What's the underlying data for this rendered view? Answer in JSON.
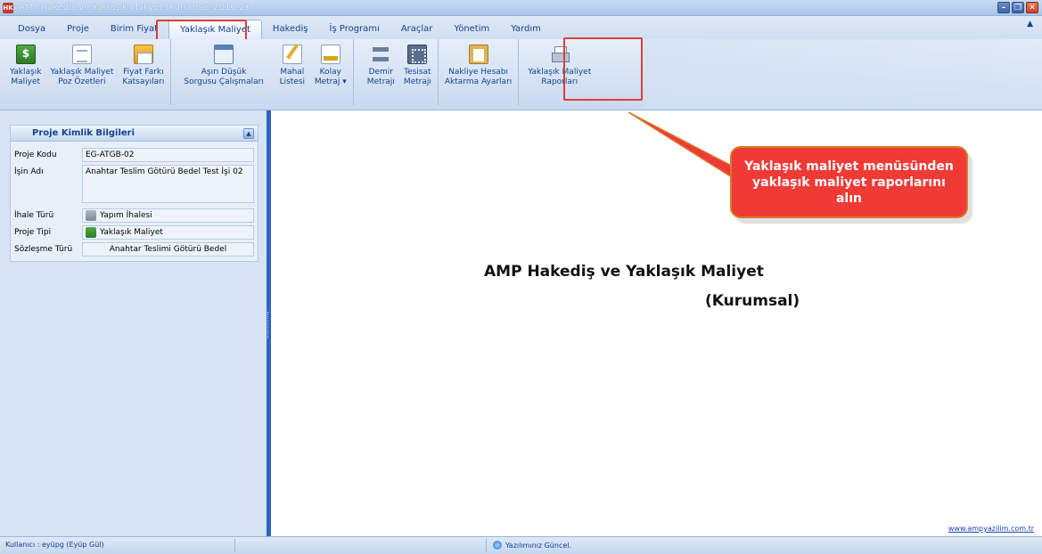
{
  "window": {
    "title": "AMP Hakediş ve Yaklaşık Maliyet (Kurumsal 2016-2)",
    "app_icon_text": "HK"
  },
  "menu": {
    "tabs": [
      "Dosya",
      "Proje",
      "Birim Fiyat",
      "Yaklaşık Maliyet",
      "Hakediş",
      "İş Programı",
      "Araçlar",
      "Yönetim",
      "Yardım"
    ],
    "active_tab": "Yaklaşık Maliyet"
  },
  "ribbon": {
    "buttons": [
      {
        "line1": "Yaklaşık",
        "line2": "Maliyet",
        "icon": "money-icon"
      },
      {
        "line1": "Yaklaşık Maliyet",
        "line2": "Poz Özetleri",
        "icon": "document-icon"
      },
      {
        "line1": "Fiyat Farkı",
        "line2": "Katsayıları",
        "icon": "table-icon"
      },
      {
        "line1": "Aşırı Düşük",
        "line2": "Sorgusu Çalışmaları",
        "icon": "window-icon"
      },
      {
        "line1": "Mahal",
        "line2": "Listesi",
        "icon": "pen-icon"
      },
      {
        "line1": "Kolay",
        "line2": "Metraj ▾",
        "icon": "ruler-icon"
      },
      {
        "line1": "Demir",
        "line2": "Metrajı",
        "icon": "beam-icon"
      },
      {
        "line1": "Tesisat",
        "line2": "Metrajı",
        "icon": "calculator-icon"
      },
      {
        "line1": "Nakliye Hesabı",
        "line2": "Aktarma Ayarları",
        "icon": "clipboard-icon"
      },
      {
        "line1": "Yaklaşık Maliyet",
        "line2": "Raporları",
        "icon": "printer-icon"
      }
    ]
  },
  "project_panel": {
    "title": "Proje Kimlik Bilgileri",
    "fields": {
      "code_label": "Proje Kodu",
      "code_value": "EG-ATGB-02",
      "name_label": "İşin Adı",
      "name_value": "Anahtar Teslim Götürü Bedel Test İşi 02",
      "tender_label": "İhale Türü",
      "tender_value": "Yapım İhalesi",
      "type_label": "Proje Tipi",
      "type_value": "Yaklaşık Maliyet",
      "contract_label": "Sözleşme Türü",
      "contract_value": "Anahtar Teslimi Götürü Bedel"
    }
  },
  "content": {
    "heading": "AMP Hakediş ve Yaklaşık Maliyet",
    "subheading": "(Kurumsal)",
    "website": "www.ampyazilim.com.tr"
  },
  "callout": {
    "text": "Yaklaşık maliyet menüsünden yaklaşık maliyet raporlarını alın"
  },
  "status": {
    "user": "Kullanıcı : eyüpg  (Eyüp Gül)",
    "update": "Yazılımınız Güncel."
  },
  "colors": {
    "accent_red": "#ef3a36",
    "splitter_blue": "#2d63c5",
    "ribbon_text": "#15428b"
  }
}
